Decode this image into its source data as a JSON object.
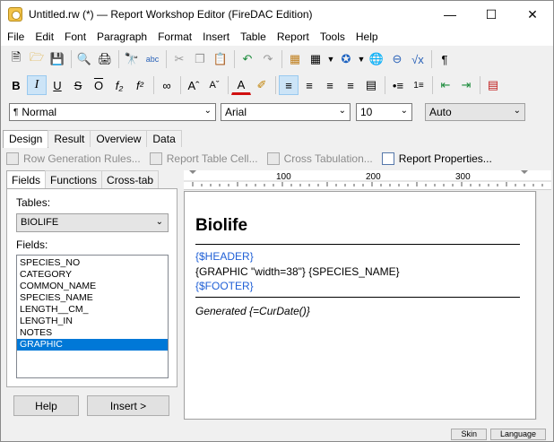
{
  "window": {
    "title": "Untitled.rw (*) — Report Workshop Editor (FireDAC Edition)"
  },
  "menu": [
    "File",
    "Edit",
    "Font",
    "Paragraph",
    "Format",
    "Insert",
    "Table",
    "Report",
    "Tools",
    "Help"
  ],
  "format": {
    "style": "Normal",
    "font": "Arial",
    "size": "10",
    "color": "Auto"
  },
  "tabs": [
    "Design",
    "Result",
    "Overview",
    "Data"
  ],
  "report_toolbar": {
    "row_generation": "Row Generation Rules...",
    "report_table_cell": "Report Table Cell...",
    "cross_tabulation": "Cross Tabulation...",
    "report_properties": "Report Properties..."
  },
  "left_panel": {
    "tabs": [
      "Fields",
      "Functions",
      "Cross-tab"
    ],
    "tables_label": "Tables:",
    "table_selected": "BIOLIFE",
    "fields_label": "Fields:",
    "fields": [
      "SPECIES_NO",
      "CATEGORY",
      "COMMON_NAME",
      "SPECIES_NAME",
      "LENGTH__CM_",
      "LENGTH_IN",
      "NOTES",
      "GRAPHIC"
    ],
    "selected_field": "GRAPHIC",
    "help_button": "Help",
    "insert_button": "Insert >"
  },
  "ruler": {
    "marks": [
      "100",
      "200",
      "300"
    ]
  },
  "document": {
    "heading": "Biolife",
    "header_tag": "{$HEADER}",
    "graphic_line": "{GRAPHIC \"width=38\"} {SPECIES_NAME}",
    "footer_tag": "{$FOOTER}",
    "generated": "Generated {=CurDate()}"
  },
  "status": {
    "skin": "Skin",
    "language": "Language"
  },
  "colors": {
    "link_blue": "#1f5fd6",
    "selection": "#0078d7"
  }
}
